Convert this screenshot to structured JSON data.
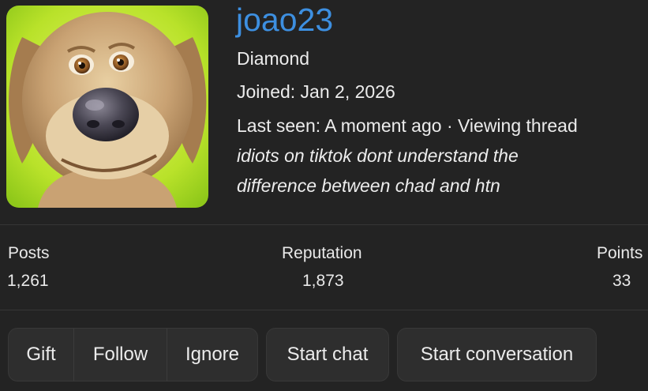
{
  "profile": {
    "username": "joao23",
    "rank": "Diamond",
    "joined": "Joined: Jan 2, 2026",
    "last_seen": "Last seen: A moment ago · Viewing thread",
    "status": "idiots on tiktok dont understand the difference between chad and htn",
    "avatar": "dog-avatar"
  },
  "stats": {
    "posts_label": "Posts",
    "posts_value": "1,261",
    "reputation_label": "Reputation",
    "reputation_value": "1,873",
    "points_label": "Points",
    "points_value": "33"
  },
  "actions": {
    "gift": "Gift",
    "follow": "Follow",
    "ignore": "Ignore",
    "start_chat": "Start chat",
    "start_conversation": "Start conversation"
  },
  "colors": {
    "background": "#232323",
    "username": "#3d8fe0",
    "button_bg": "#2e2e2e"
  }
}
